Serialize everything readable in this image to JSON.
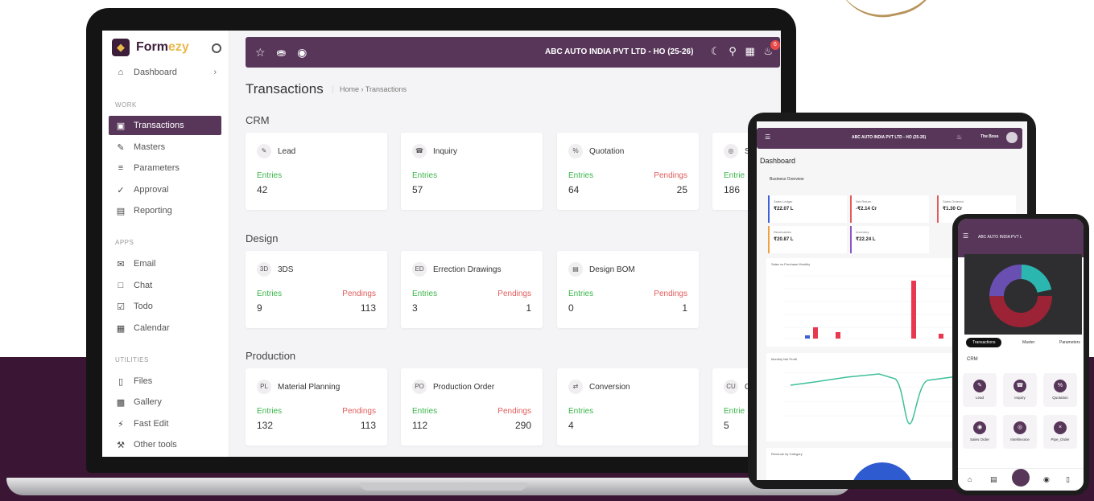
{
  "brand": {
    "name_main": "Form",
    "name_accent": "ezy",
    "colors": {
      "primary": "#58365a",
      "dark": "#3a1534",
      "gold": "#e8b84a",
      "green": "#3bb54a",
      "red": "#e25b5b"
    }
  },
  "sidebar": {
    "dashboard": {
      "label": "Dashboard",
      "icon": "home-icon"
    },
    "sections": [
      {
        "label": "WORK",
        "items": [
          {
            "label": "Transactions",
            "icon": "cube-icon",
            "active": true
          },
          {
            "label": "Masters",
            "icon": "edit-square-icon"
          },
          {
            "label": "Parameters",
            "icon": "list-icon"
          },
          {
            "label": "Approval",
            "icon": "check-icon"
          },
          {
            "label": "Reporting",
            "icon": "report-icon"
          }
        ]
      },
      {
        "label": "APPS",
        "items": [
          {
            "label": "Email",
            "icon": "mail-icon"
          },
          {
            "label": "Chat",
            "icon": "chat-icon"
          },
          {
            "label": "Todo",
            "icon": "checkbox-icon"
          },
          {
            "label": "Calendar",
            "icon": "calendar-icon"
          }
        ]
      },
      {
        "label": "UTILITIES",
        "items": [
          {
            "label": "Files",
            "icon": "file-icon"
          },
          {
            "label": "Gallery",
            "icon": "image-icon"
          },
          {
            "label": "Fast Edit",
            "icon": "bolt-icon"
          },
          {
            "label": "Other tools",
            "icon": "wrench-icon"
          }
        ]
      }
    ]
  },
  "topbar": {
    "company": "ABC AUTO INDIA PVT LTD - HO (25-26)",
    "notification_count": "6",
    "left_icons": [
      "star-icon",
      "truck-icon",
      "camera-icon"
    ],
    "right_icons": [
      "moon-icon",
      "search-icon",
      "grid-icon",
      "bell-icon"
    ]
  },
  "page": {
    "title": "Transactions",
    "breadcrumb": "Home › Transactions"
  },
  "groups": [
    {
      "title": "CRM",
      "cards": [
        {
          "abbr": "✎",
          "name": "Lead",
          "entries_label": "Entries",
          "entries": "42",
          "pendings_label": "",
          "pendings": ""
        },
        {
          "abbr": "☎",
          "name": "Inquiry",
          "entries_label": "Entries",
          "entries": "57",
          "pendings_label": "",
          "pendings": ""
        },
        {
          "abbr": "%",
          "name": "Quotation",
          "entries_label": "Entries",
          "entries": "64",
          "pendings_label": "Pendings",
          "pendings": "25"
        },
        {
          "abbr": "◎",
          "name": "S",
          "entries_label": "Entrie",
          "entries": "186",
          "pendings_label": "",
          "pendings": ""
        }
      ]
    },
    {
      "title": "Design",
      "cards": [
        {
          "abbr": "3D",
          "name": "3DS",
          "entries_label": "Entries",
          "entries": "9",
          "pendings_label": "Pendings",
          "pendings": "113"
        },
        {
          "abbr": "ED",
          "name": "Errection Drawings",
          "entries_label": "Entries",
          "entries": "3",
          "pendings_label": "Pendings",
          "pendings": "1"
        },
        {
          "abbr": "▤",
          "name": "Design BOM",
          "entries_label": "Entries",
          "entries": "0",
          "pendings_label": "Pendings",
          "pendings": "1"
        }
      ]
    },
    {
      "title": "Production",
      "cards": [
        {
          "abbr": "PL",
          "name": "Material Planning",
          "entries_label": "Entries",
          "entries": "132",
          "pendings_label": "Pendings",
          "pendings": "113"
        },
        {
          "abbr": "PO",
          "name": "Production Order",
          "entries_label": "Entries",
          "entries": "112",
          "pendings_label": "Pendings",
          "pendings": "290"
        },
        {
          "abbr": "⇄",
          "name": "Conversion",
          "entries_label": "Entries",
          "entries": "4",
          "pendings_label": "",
          "pendings": ""
        },
        {
          "abbr": "CU",
          "name": "C",
          "entries_label": "Entrie",
          "entries": "5",
          "pendings_label": "",
          "pendings": ""
        }
      ]
    }
  ],
  "tablet": {
    "company": "ABC AUTO INDIA PVT LTD - HO (25-26)",
    "user": "The Boss",
    "title": "Dashboard",
    "subtitle": "Business Overview",
    "kpis": [
      {
        "label": "Sales Ledger",
        "value": "₹22.07 L",
        "color": "#3d5fd8"
      },
      {
        "label": "Net Return",
        "value": "-₹2.14 Cr",
        "color": "#e25b5b"
      },
      {
        "label": "Sales Ordered",
        "value": "₹1.30 Cr",
        "color": "#e25b5b"
      },
      {
        "label": "Receivables",
        "value": "₹20.87 L",
        "color": "#f0a040"
      },
      {
        "label": "Inventory",
        "value": "₹22.24 L",
        "color": "#8a56c8"
      }
    ],
    "panels": [
      "Sales vs Purchase Monthly",
      "Monthly Net Profit",
      "Revenue by Category"
    ]
  },
  "phone": {
    "company": "ABC AUTO INDIA PVT L",
    "tabs": [
      "Transactions",
      "Master",
      "Parameters"
    ],
    "section": "CRM",
    "tiles": [
      "Lead",
      "Inquiry",
      "Quotation",
      "Sales Order",
      "Intellinvoice",
      "Pipe_Order"
    ]
  }
}
